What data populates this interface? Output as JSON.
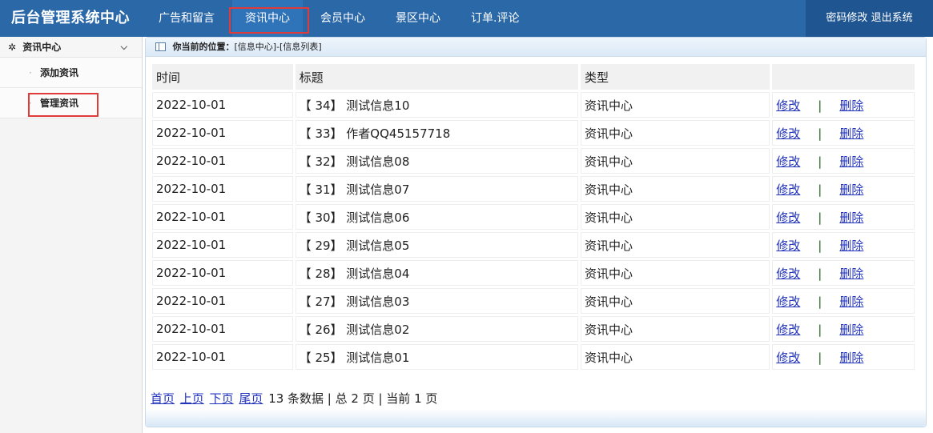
{
  "header": {
    "logo": "后台管理系统中心",
    "nav": [
      {
        "label": "广告和留言"
      },
      {
        "label": "资讯中心"
      },
      {
        "label": "会员中心"
      },
      {
        "label": "景区中心"
      },
      {
        "label": "订单.评论"
      }
    ],
    "password_change": "密码修改",
    "logout": "退出系统"
  },
  "sidebar": {
    "title": "资讯中心",
    "items": [
      {
        "label": "添加资讯"
      },
      {
        "label": "管理资讯"
      }
    ]
  },
  "breadcrumb": {
    "prefix": "你当前的位置：",
    "path": "[信息中心]-[信息列表]"
  },
  "table": {
    "headers": [
      "时间",
      "标题",
      "类型",
      ""
    ],
    "edit_label": "修改",
    "delete_label": "删除",
    "separator": "|",
    "rows": [
      {
        "time": "2022-10-01",
        "title": "【 34】 测试信息10",
        "type": "资讯中心"
      },
      {
        "time": "2022-10-01",
        "title": "【 33】 作者QQ45157718",
        "type": "资讯中心"
      },
      {
        "time": "2022-10-01",
        "title": "【 32】 测试信息08",
        "type": "资讯中心"
      },
      {
        "time": "2022-10-01",
        "title": "【 31】 测试信息07",
        "type": "资讯中心"
      },
      {
        "time": "2022-10-01",
        "title": "【 30】 测试信息06",
        "type": "资讯中心"
      },
      {
        "time": "2022-10-01",
        "title": "【 29】 测试信息05",
        "type": "资讯中心"
      },
      {
        "time": "2022-10-01",
        "title": "【 28】 测试信息04",
        "type": "资讯中心"
      },
      {
        "time": "2022-10-01",
        "title": "【 27】 测试信息03",
        "type": "资讯中心"
      },
      {
        "time": "2022-10-01",
        "title": "【 26】 测试信息02",
        "type": "资讯中心"
      },
      {
        "time": "2022-10-01",
        "title": "【 25】 测试信息01",
        "type": "资讯中心"
      }
    ]
  },
  "pager": {
    "first": "首页",
    "prev": "上页",
    "next": "下页",
    "last": "尾页",
    "summary": "13 条数据 | 总 2 页 | 当前 1 页"
  },
  "colors": {
    "header_bg": "#2b68a8",
    "header_right_bg": "#1f5591",
    "highlight_border": "#e03a3a",
    "link": "#2233bb"
  }
}
